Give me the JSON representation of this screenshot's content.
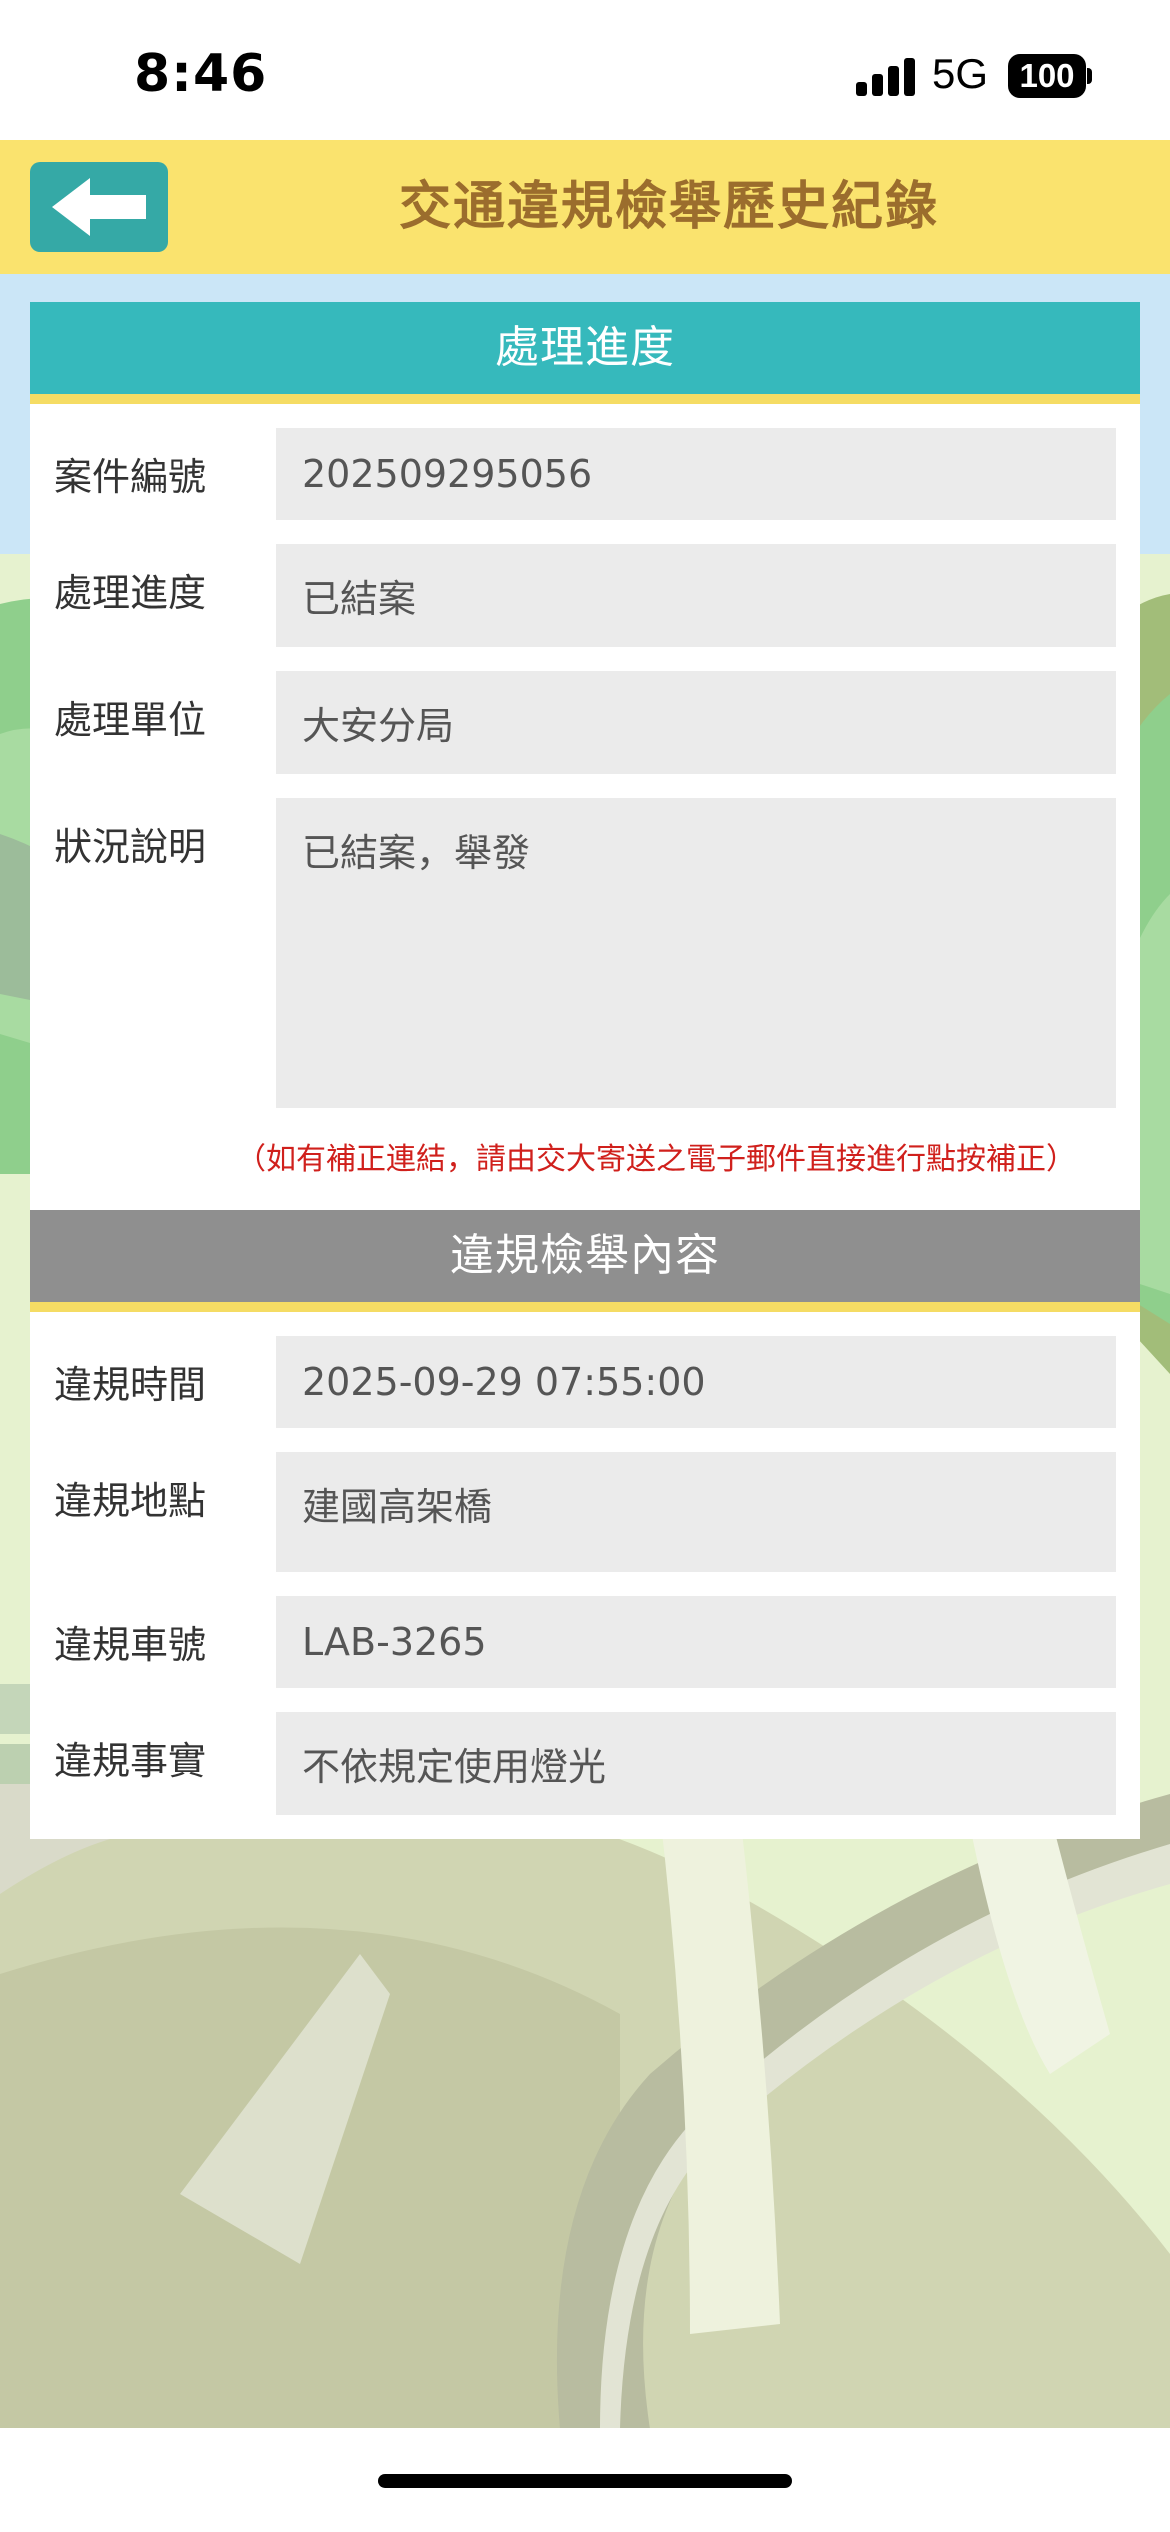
{
  "status_bar": {
    "time": "8:46",
    "network": "5G",
    "battery": "100"
  },
  "header": {
    "title": "交通違規檢舉歷史紀錄",
    "back_icon": "arrow-left-icon"
  },
  "progress_section": {
    "title": "處理進度",
    "rows": [
      {
        "label": "案件編號",
        "value": "202509295056"
      },
      {
        "label": "處理進度",
        "value": "已結案"
      },
      {
        "label": "處理單位",
        "value": "大安分局"
      },
      {
        "label": "狀況說明",
        "value": "已結案，舉發"
      }
    ],
    "notice": "（如有補正連結，請由交大寄送之電子郵件直接進行點按補正）"
  },
  "report_section": {
    "title": "違規檢舉內容",
    "rows": [
      {
        "label": "違規時間",
        "value": "2025-09-29 07:55:00"
      },
      {
        "label": "違規地點",
        "value": "建國高架橋"
      },
      {
        "label": "違規車號",
        "value": "LAB-3265"
      },
      {
        "label": "違規事實",
        "value": "不依規定使用燈光"
      }
    ]
  },
  "colors": {
    "header_bg": "#fae36e",
    "title_text": "#9b6d2d",
    "accent_teal": "#36b9bc",
    "section_gray": "#8f8f8f",
    "notice_red": "#d0201c"
  }
}
